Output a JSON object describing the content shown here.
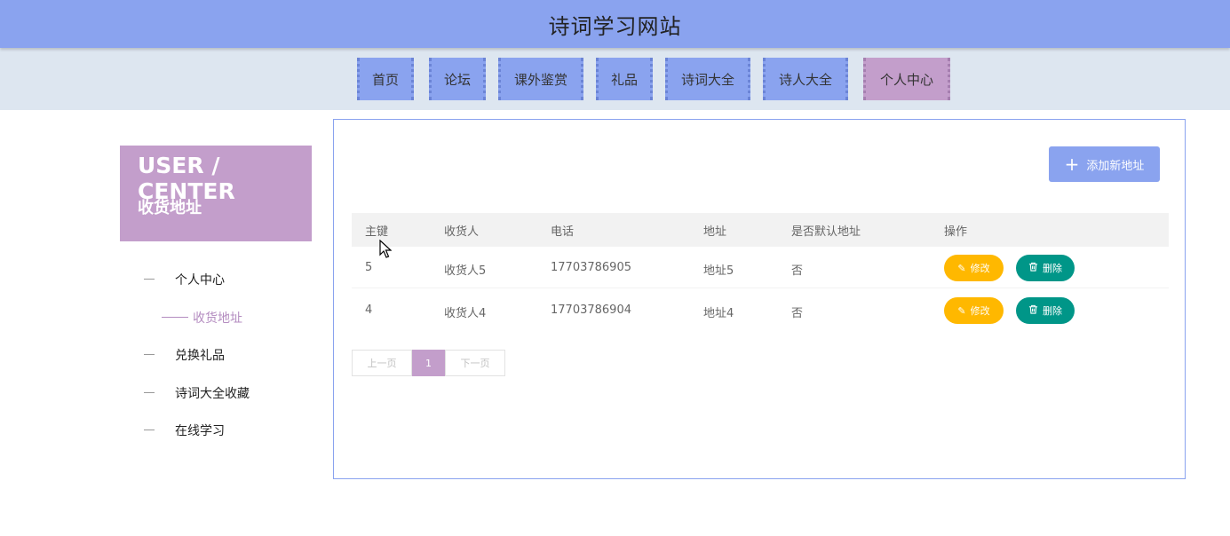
{
  "header": {
    "title": "诗词学习网站"
  },
  "nav": {
    "items": [
      {
        "label": "首页"
      },
      {
        "label": "论坛"
      },
      {
        "label": "课外鉴赏"
      },
      {
        "label": "礼品"
      },
      {
        "label": "诗词大全"
      },
      {
        "label": "诗人大全"
      },
      {
        "label": "个人中心"
      }
    ],
    "active_index": 6
  },
  "sidebar": {
    "banner_en": "USER / CENTER",
    "banner_cn": "收货地址",
    "items": [
      {
        "label": "个人中心"
      },
      {
        "label": "收货地址"
      },
      {
        "label": "兑换礼品"
      },
      {
        "label": "诗词大全收藏"
      },
      {
        "label": "在线学习"
      }
    ],
    "active_index": 1
  },
  "main": {
    "add_button_label": "添加新地址",
    "table": {
      "columns": [
        "主键",
        "收货人",
        "电话",
        "地址",
        "是否默认地址",
        "操作"
      ],
      "rows": [
        {
          "id": "5",
          "receiver": "收货人5",
          "phone": "17703786905",
          "address": "地址5",
          "is_default": "否"
        },
        {
          "id": "4",
          "receiver": "收货人4",
          "phone": "17703786904",
          "address": "地址4",
          "is_default": "否"
        }
      ],
      "edit_label": "修改",
      "delete_label": "删除"
    },
    "pagination": {
      "prev": "上一页",
      "current": "1",
      "next": "下一页"
    }
  },
  "colors": {
    "primary": "#8aa3ef",
    "accent": "#c39ecb",
    "warning": "#ffb800",
    "teal": "#009688",
    "navbar_bg": "#dde6f0"
  },
  "icons": [
    "plus-icon",
    "pencil-icon",
    "trash-icon",
    "mouse-cursor-icon"
  ]
}
